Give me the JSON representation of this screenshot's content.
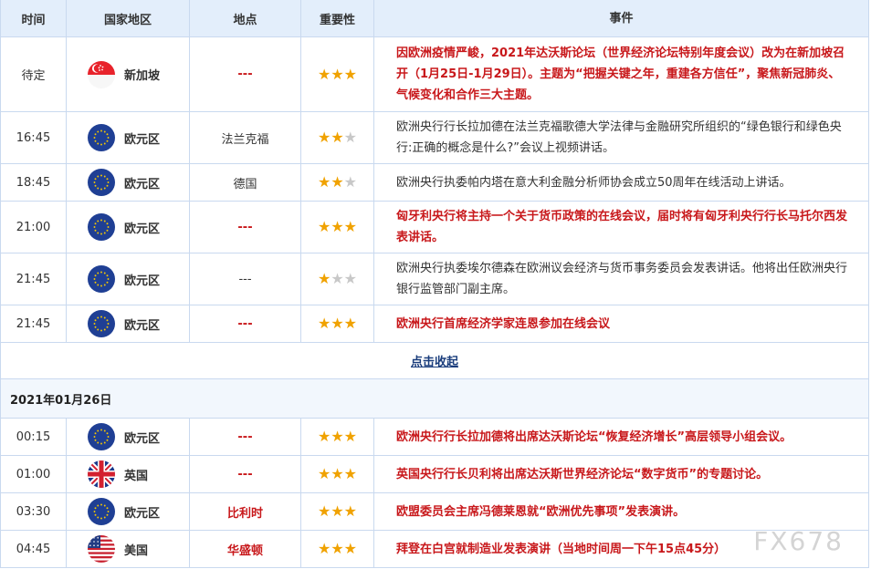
{
  "headers": {
    "time": "时间",
    "country": "国家地区",
    "place": "地点",
    "importance": "重要性",
    "event": "事件"
  },
  "rows_day1": [
    {
      "time": "待定",
      "flag": "singapore-flag",
      "country": "新加坡",
      "place": "---",
      "place_style": "red",
      "stars": 3,
      "event": "因欧洲疫情严峻，2021年达沃斯论坛（世界经济论坛特别年度会议）改为在新加坡召开（1月25日-1月29日）。主题为“把握关键之年，重建各方信任”，聚焦新冠肺炎、气候变化和合作三大主题。",
      "event_style": "red"
    },
    {
      "time": "16:45",
      "flag": "eu-flag",
      "country": "欧元区",
      "place": "法兰克福",
      "place_style": "plain",
      "stars": 2,
      "event": "欧洲央行行长拉加德在法兰克福歌德大学法律与金融研究所组织的“绿色银行和绿色央行:正确的概念是什么?”会议上视频讲话。",
      "event_style": "plain"
    },
    {
      "time": "18:45",
      "flag": "eu-flag",
      "country": "欧元区",
      "place": "德国",
      "place_style": "plain",
      "stars": 2,
      "event": "欧洲央行执委帕内塔在意大利金融分析师协会成立50周年在线活动上讲话。",
      "event_style": "plain"
    },
    {
      "time": "21:00",
      "flag": "eu-flag",
      "country": "欧元区",
      "place": "---",
      "place_style": "red",
      "stars": 3,
      "event": "匈牙利央行将主持一个关于货币政策的在线会议，届时将有匈牙利央行行长马托尔西发表讲话。",
      "event_style": "red"
    },
    {
      "time": "21:45",
      "flag": "eu-flag",
      "country": "欧元区",
      "place": "---",
      "place_style": "plain",
      "stars": 1,
      "event": "欧洲央行执委埃尔德森在欧洲议会经济与货币事务委员会发表讲话。他将出任欧洲央行银行监管部门副主席。",
      "event_style": "plain"
    },
    {
      "time": "21:45",
      "flag": "eu-flag",
      "country": "欧元区",
      "place": "---",
      "place_style": "red",
      "stars": 3,
      "event": "欧洲央行首席经济学家连恩参加在线会议",
      "event_style": "red"
    }
  ],
  "collapse_label": "点击收起",
  "date_label": "2021年01月26日",
  "rows_day2": [
    {
      "time": "00:15",
      "flag": "eu-flag",
      "country": "欧元区",
      "place": "---",
      "place_style": "red",
      "stars": 3,
      "event": "欧洲央行行长拉加德将出席达沃斯论坛“恢复经济增长”高层领导小组会议。",
      "event_style": "red"
    },
    {
      "time": "01:00",
      "flag": "uk-flag",
      "country": "英国",
      "place": "---",
      "place_style": "red",
      "stars": 3,
      "event": "英国央行行长贝利将出席达沃斯世界经济论坛“数字货币”的专题讨论。",
      "event_style": "red"
    },
    {
      "time": "03:30",
      "flag": "eu-flag",
      "country": "欧元区",
      "place": "比利时",
      "place_style": "red",
      "stars": 3,
      "event": "欧盟委员会主席冯德莱恩就“欧洲优先事项”发表演讲。",
      "event_style": "red"
    },
    {
      "time": "04:45",
      "flag": "us-flag",
      "country": "美国",
      "place": "华盛顿",
      "place_style": "red",
      "stars": 3,
      "event": "拜登在白宫就制造业发表演讲（当地时间周一下午15点45分）",
      "event_style": "red"
    }
  ],
  "watermark": "FX678",
  "colors": {
    "header_bg": "#e3eefb",
    "border": "#c9d9ef",
    "accent_red": "#c8181b",
    "star": "#f0a200",
    "star_off": "#c8c8c8"
  }
}
